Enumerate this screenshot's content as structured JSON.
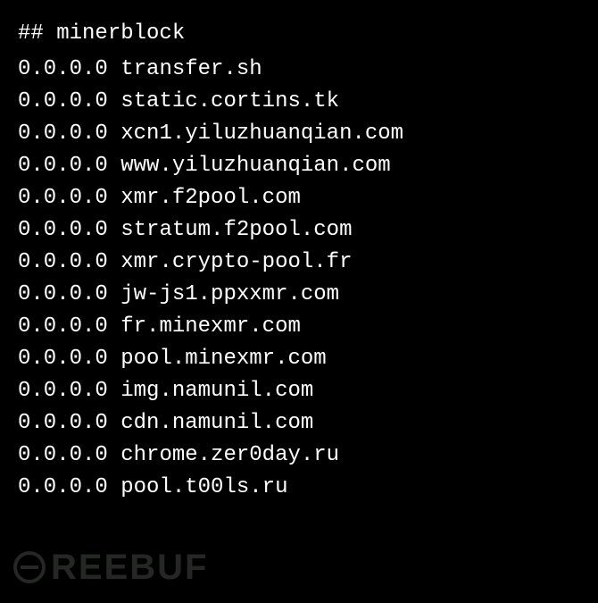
{
  "header": "## minerblock",
  "entries": [
    {
      "ip": "0.0.0.0",
      "host": "transfer.sh"
    },
    {
      "ip": "0.0.0.0",
      "host": "static.cortins.tk"
    },
    {
      "ip": "0.0.0.0",
      "host": "xcn1.yiluzhuanqian.com"
    },
    {
      "ip": "0.0.0.0",
      "host": "www.yiluzhuanqian.com"
    },
    {
      "ip": "0.0.0.0",
      "host": "xmr.f2pool.com"
    },
    {
      "ip": "0.0.0.0",
      "host": "stratum.f2pool.com"
    },
    {
      "ip": "0.0.0.0",
      "host": "xmr.crypto-pool.fr"
    },
    {
      "ip": "0.0.0.0",
      "host": "jw-js1.ppxxmr.com"
    },
    {
      "ip": "0.0.0.0",
      "host": "fr.minexmr.com"
    },
    {
      "ip": "0.0.0.0",
      "host": "pool.minexmr.com"
    },
    {
      "ip": "0.0.0.0",
      "host": "img.namunil.com"
    },
    {
      "ip": "0.0.0.0",
      "host": "cdn.namunil.com"
    },
    {
      "ip": "0.0.0.0",
      "host": "chrome.zer0day.ru"
    },
    {
      "ip": "0.0.0.0",
      "host": "pool.t00ls.ru"
    }
  ],
  "watermark": "REEBUF"
}
